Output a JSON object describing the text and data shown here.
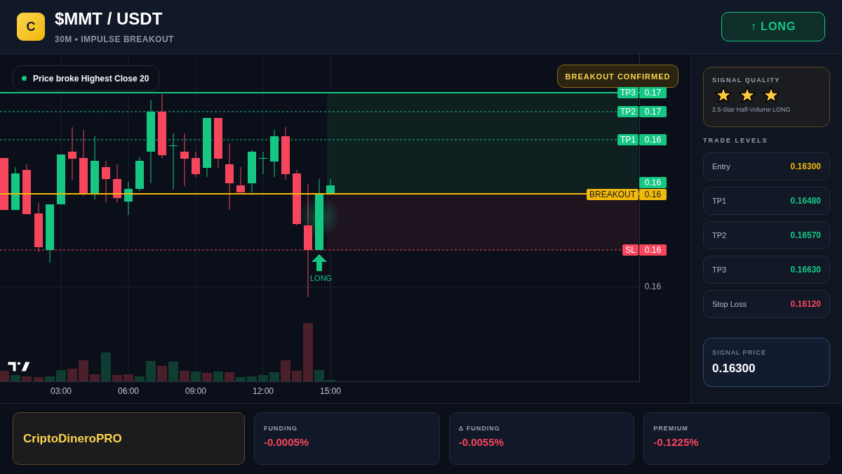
{
  "header": {
    "logo_letter": "C",
    "title": "$MMT / USDT",
    "subtitle": "30M • IMPULSE BREAKOUT",
    "signal_button": "↑ LONG"
  },
  "chart": {
    "note": "Price broke Highest Close 20",
    "status_badge": "BREAKOUT CONFIRMED",
    "price_labels": [
      {
        "label": "TP3",
        "value": "0.17",
        "kind": "tp"
      },
      {
        "label": "TP2",
        "value": "0.17",
        "kind": "tp"
      },
      {
        "label": "TP1",
        "value": "0.16",
        "kind": "tp"
      },
      {
        "value": "0.16",
        "kind": "current"
      },
      {
        "label": "BREAKOUT",
        "value": "0.16",
        "kind": "breakout"
      },
      {
        "label": "SL",
        "value": "0.16",
        "kind": "sl"
      },
      {
        "value": "0.16",
        "kind": "axis"
      }
    ],
    "signal_marker": "LONG",
    "time_labels": [
      "03:00",
      "06:00",
      "09:00",
      "12:00",
      "15:00"
    ]
  },
  "sidebar": {
    "signal_quality": {
      "title": "SIGNAL QUALITY",
      "stars": 3,
      "caption": "2.5-Star Half-Volume LONG"
    },
    "trade_levels_title": "TRADE LEVELS",
    "trade_levels": [
      {
        "label": "Entry",
        "value": "0.16300",
        "kind": "entry"
      },
      {
        "label": "TP1",
        "value": "0.16480",
        "kind": "tp"
      },
      {
        "label": "TP2",
        "value": "0.16570",
        "kind": "tp"
      },
      {
        "label": "TP3",
        "value": "0.16630",
        "kind": "tp"
      },
      {
        "label": "Stop Loss",
        "value": "0.16120",
        "kind": "sl"
      }
    ],
    "signal_price": {
      "label": "SIGNAL PRICE",
      "value": "0.16300"
    }
  },
  "footer": {
    "brand": "CriptoDineroPRO",
    "stats": [
      {
        "label": "FUNDING",
        "value": "-0.0005%"
      },
      {
        "label": "Δ FUNDING",
        "value": "-0.0055%"
      },
      {
        "label": "PREMIUM",
        "value": "-0.1225%"
      }
    ]
  }
}
